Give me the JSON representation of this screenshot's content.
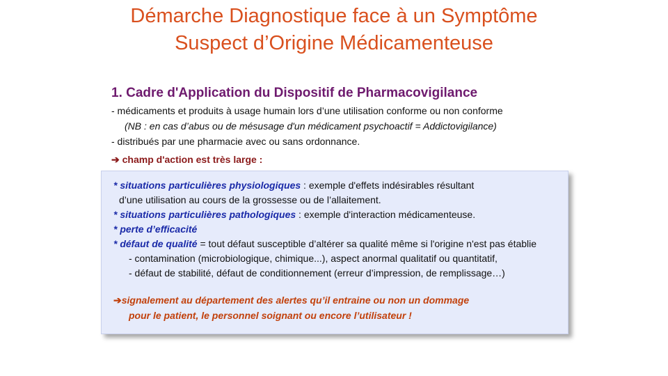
{
  "title": {
    "line1": "Démarche Diagnostique face à un Symptôme",
    "line2": "Suspect d’Origine Médicamenteuse"
  },
  "section": {
    "heading": "1. Cadre d'Application du Dispositif de Pharmacovigilance",
    "line1": "- médicaments et produits à usage humain lors d’une utilisation  conforme ou non conforme",
    "nb": "(NB : en cas d’abus ou de mésusage d'un médicament psychoactif = Addictovigilance)",
    "line2": "- distribués  par une pharmacie avec ou sans ordonnance.",
    "scope_arrow": "➔",
    "scope": " champ d'action est très large :"
  },
  "box": {
    "item1_label": "* situations particulières physiologiques",
    "item1_text": " : exemple d'effets  indésirables  résultant",
    "item1_cont": "d’une utilisation  au cours de la grossesse ou de l’allaitement.",
    "item2_label": "* situations particulières pathologiques",
    "item2_text": " : exemple d'interaction  médicamenteuse.",
    "item3_label": "* perte d’efficacité",
    "item4_label": "* défaut de qualité",
    "item4_text": " = tout  défaut  susceptible  d’altérer sa qualité  même si l'origine n'est pas établie",
    "sub1": "- contamination  (microbiologique,  chimique...),  aspect anormal qualitatif  ou quantitatif,",
    "sub2": "- défaut de stabilité,  défaut de conditionnement  (erreur d’impression, de remplissage…)",
    "alert_arrow": "➔",
    "alert_line1": "signalement au département des alertes qu’il entraine ou non un dommage",
    "alert_line2": "pour le patient, le personnel soignant ou encore l’utilisateur !"
  }
}
